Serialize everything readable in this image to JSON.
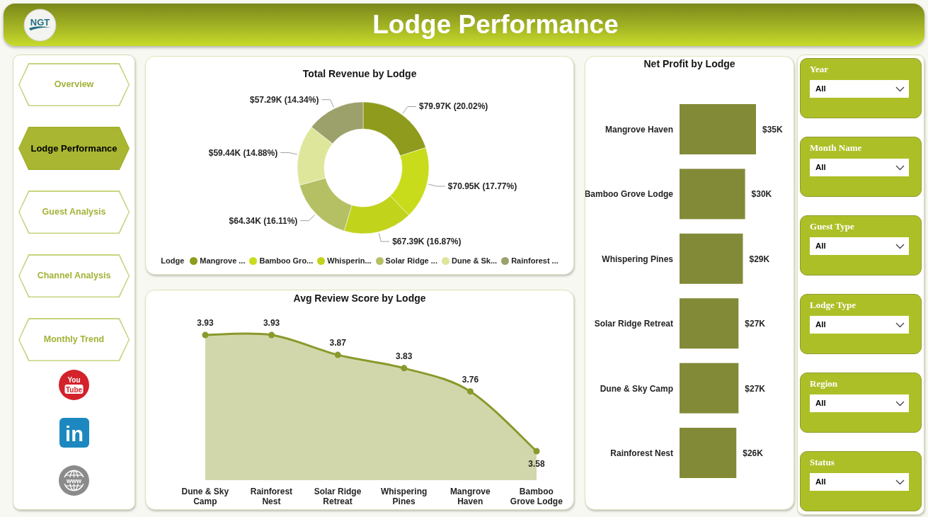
{
  "header": {
    "logo_text": "NGT",
    "title": "Lodge Performance"
  },
  "nav": [
    {
      "label": "Overview",
      "selected": false
    },
    {
      "label": "Lodge Performance",
      "selected": true
    },
    {
      "label": "Guest Analysis",
      "selected": false
    },
    {
      "label": "Channel Analysis",
      "selected": false
    },
    {
      "label": "Monthly Trend",
      "selected": false
    }
  ],
  "social_links": [
    {
      "kind": "youtube",
      "lines": [
        "You",
        "Tube"
      ]
    },
    {
      "kind": "linkedin",
      "lines": [
        "in"
      ]
    },
    {
      "kind": "website",
      "lines": [
        "www"
      ]
    }
  ],
  "revenue_chart": {
    "chart_data": {
      "type": "donut",
      "title": "Total Revenue by Lodge",
      "legend": "bottom",
      "legend_title": "Lodge",
      "categories": [
        "Mangrove ...",
        "Bamboo Gro...",
        "Whisperin...",
        "Solar Ridge ...",
        "Dune & Sk...",
        "Rainforest ..."
      ],
      "colors": [
        "#8e9b1c",
        "#c8dc1c",
        "#c1d31b",
        "#b5c064",
        "#dee69c",
        "#9ca06b"
      ],
      "values": [
        79970,
        70950,
        67390,
        64340,
        59440,
        57290
      ],
      "value_labels": [
        "$79.97K (20.02%)",
        "$70.95K (17.77%)",
        "$67.39K (16.87%)",
        "$64.34K (16.11%)",
        "$59.44K (14.88%)",
        "$57.29K (14.34%)"
      ]
    }
  },
  "review_chart": {
    "chart_data": {
      "type": "area",
      "title": "Avg Review Score by Lodge",
      "categories": [
        "Dune & Sky Camp",
        "Rainforest Nest",
        "Solar Ridge Retreat",
        "Whispering Pines",
        "Mangrove Haven",
        "Bamboo Grove Lodge"
      ],
      "values": [
        3.93,
        3.93,
        3.87,
        3.83,
        3.76,
        3.58
      ],
      "data_labels": true
    }
  },
  "profit_chart": {
    "chart_data": {
      "type": "bar",
      "orientation": "horizontal",
      "title": "Net Profit by Lodge",
      "categories": [
        "Mangrove Haven",
        "Bamboo Grove Lodge",
        "Whispering Pines",
        "Solar Ridge Retreat",
        "Dune & Sky Camp",
        "Rainforest Nest"
      ],
      "values": [
        35,
        30,
        29,
        27,
        27,
        26
      ],
      "value_labels": [
        "$35K",
        "$30K",
        "$29K",
        "$27K",
        "$27K",
        "$26K"
      ]
    }
  },
  "filters": [
    {
      "label": "Year",
      "value": "All"
    },
    {
      "label": "Month Name",
      "value": "All"
    },
    {
      "label": "Guest Type",
      "value": "All"
    },
    {
      "label": "Lodge Type",
      "value": "All"
    },
    {
      "label": "Region",
      "value": "All"
    },
    {
      "label": "Status",
      "value": "All"
    }
  ]
}
